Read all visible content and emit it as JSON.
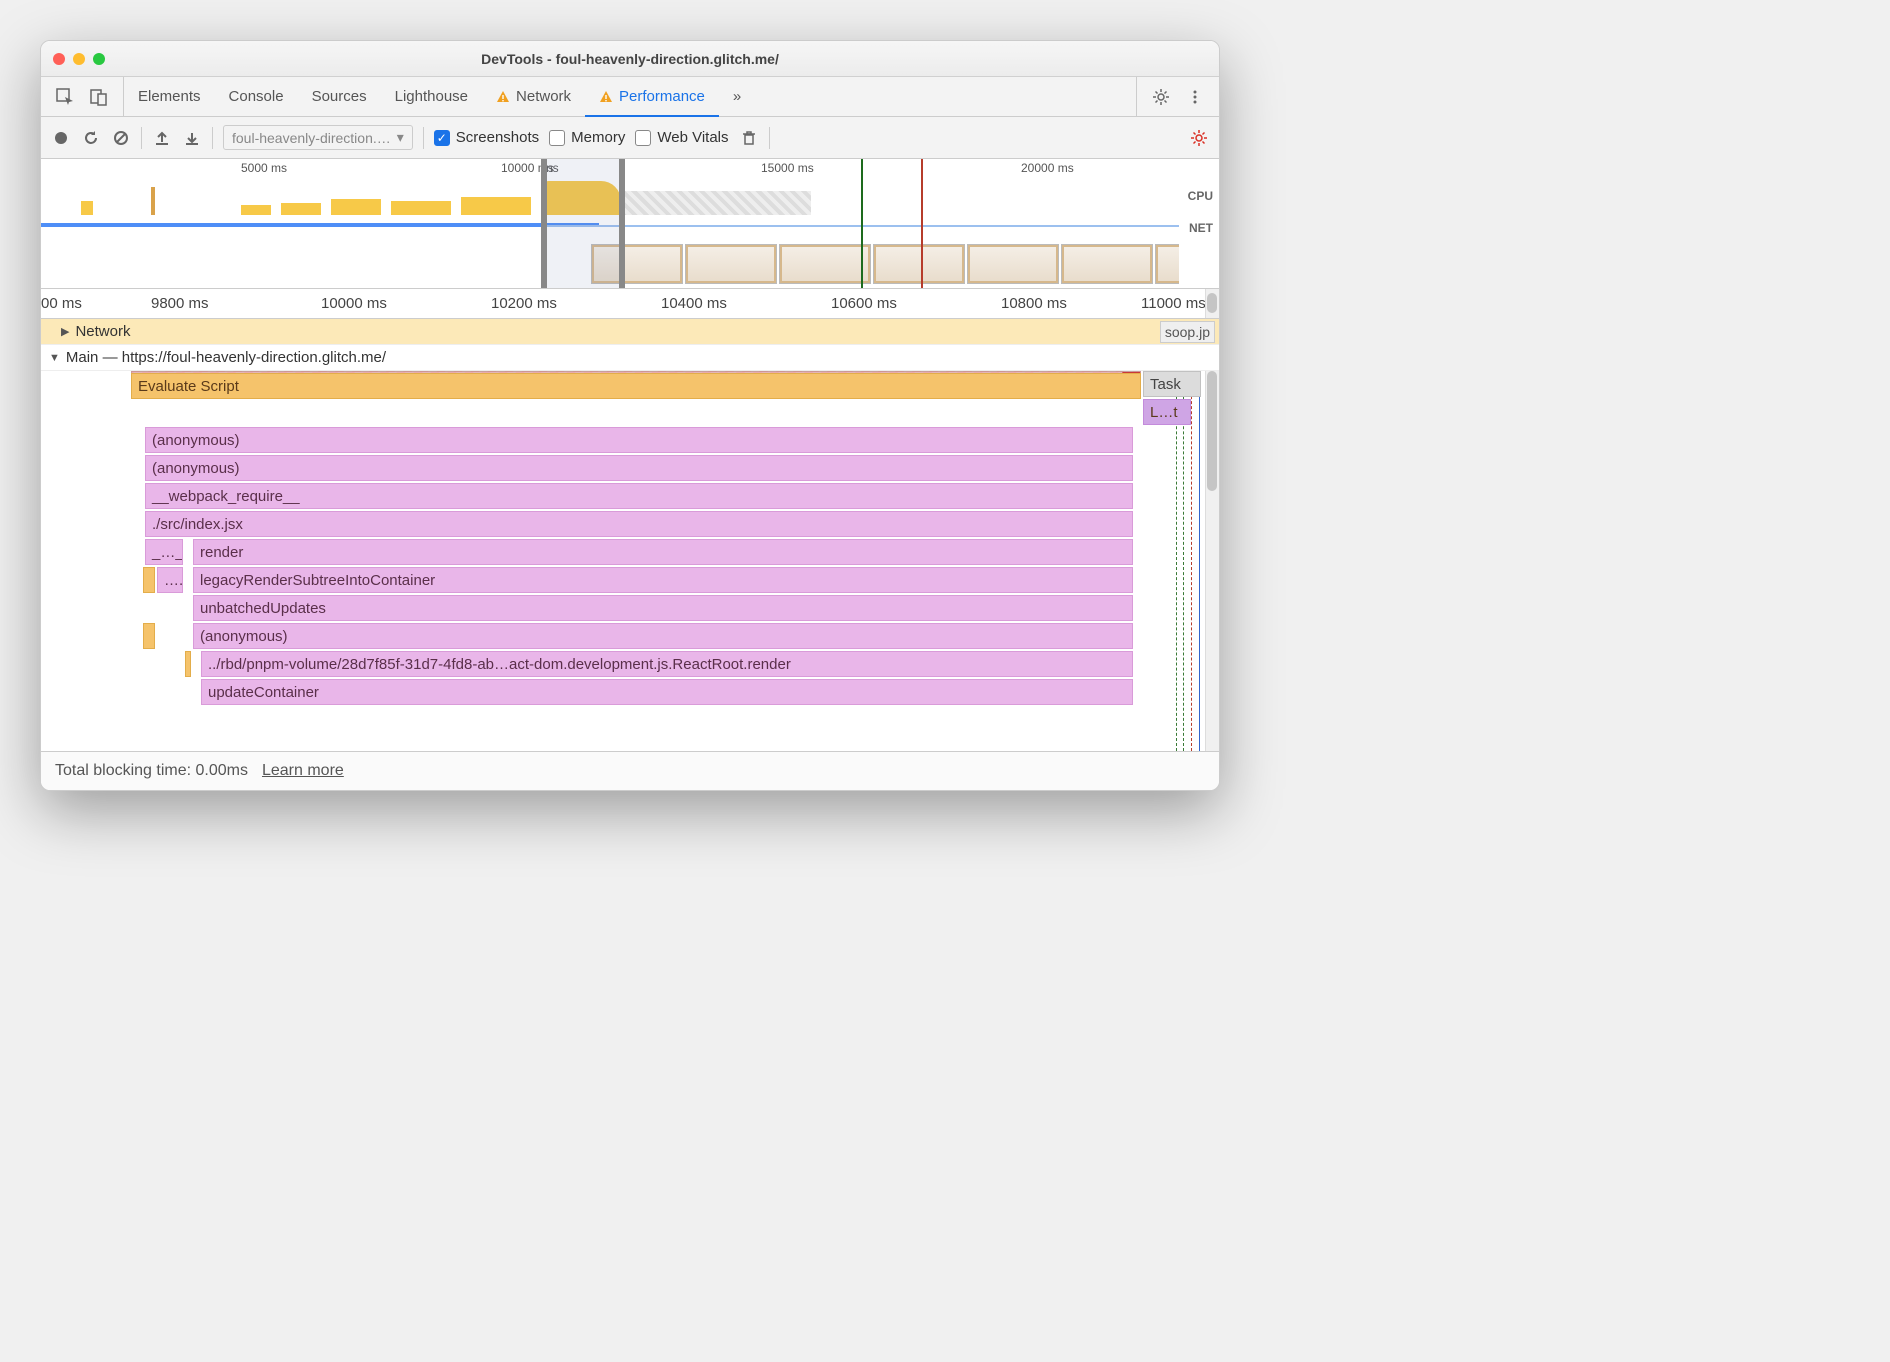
{
  "window": {
    "title": "DevTools - foul-heavenly-direction.glitch.me/"
  },
  "tabs": {
    "elements": "Elements",
    "console": "Console",
    "sources": "Sources",
    "lighthouse": "Lighthouse",
    "network": "Network",
    "performance": "Performance"
  },
  "toolbar": {
    "profile_select": "foul-heavenly-direction.…",
    "screenshots": "Screenshots",
    "memory": "Memory",
    "web_vitals": "Web Vitals"
  },
  "overview": {
    "ticks": [
      "5000 ms",
      "10000 ms",
      "15000 ms",
      "20000 ms"
    ],
    "right_clip": "ns",
    "cpu_label": "CPU",
    "net_label": "NET"
  },
  "timeline": {
    "ticks": [
      "00 ms",
      "9800 ms",
      "10000 ms",
      "10200 ms",
      "10400 ms",
      "10600 ms",
      "10800 ms",
      "11000 ms"
    ]
  },
  "groups": {
    "network": {
      "label": "Network",
      "tail": "soop.jp"
    },
    "main": {
      "label": "Main — https://foul-heavenly-direction.glitch.me/"
    }
  },
  "flame": {
    "task": "Task",
    "task2": "Task",
    "lt": "L…t",
    "eval": "Evaluate Script",
    "anon1": "(anonymous)",
    "anon2": "(anonymous)",
    "webpack": "__webpack_require__",
    "srcindex": "./src/index.jsx",
    "dots1": "_…_",
    "render": "render",
    "dots2": "….",
    "legacy": "legacyRenderSubtreeIntoContainer",
    "unbatched": "unbatchedUpdates",
    "anon3": "(anonymous)",
    "rbd": "../rbd/pnpm-volume/28d7f85f-31d7-4fd8-ab…act-dom.development.js.ReactRoot.render",
    "updatec": "updateContainer"
  },
  "footer": {
    "tbt": "Total blocking time: 0.00ms",
    "learn": "Learn more"
  }
}
